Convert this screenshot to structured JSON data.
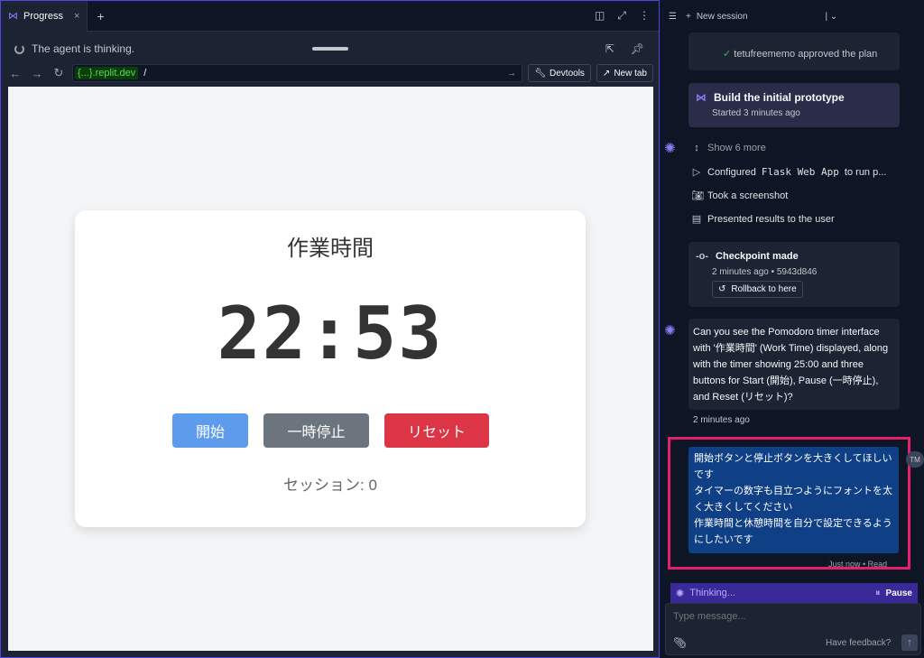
{
  "tab": {
    "label": "Progress",
    "close": "×",
    "add": "+"
  },
  "status": {
    "text": "The agent is thinking."
  },
  "url": {
    "domain": "{...}.replit.dev",
    "path": "/",
    "devtools": "Devtools",
    "newtab": "New tab"
  },
  "app": {
    "title": "作業時間",
    "time": "22:53",
    "start": "開始",
    "pause": "一時停止",
    "reset": "リセット",
    "session": "セッション: 0"
  },
  "side": {
    "new_session": "New session",
    "approved": "tetufreememo approved the plan",
    "task_title": "Build the initial prototype",
    "task_sub": "Started 3 minutes ago",
    "show_more": "Show 6 more",
    "step1_pre": "Configured",
    "step1_code": "Flask Web App",
    "step1_post": "to run p...",
    "step2": "Took a screenshot",
    "step3": "Presented results to the user",
    "checkpoint": "Checkpoint made",
    "checkpoint_meta": "2 minutes ago • 5943d846",
    "rollback": "Rollback to here",
    "agent_msg": "Can you see the Pomodoro timer interface with '作業時間' (Work Time) displayed, along with the timer showing 25:00 and three buttons for Start (開始), Pause (一時停止), and Reset (リセット)?",
    "agent_time": "2 minutes ago",
    "user_msg": "開始ボタンと停止ボタンを大きくしてほしいです\nタイマーの数字も目立つようにフォントを太く大きくしてください\n作業時間と休憩時間を自分で設定できるようにしたいです",
    "user_initials": "TM",
    "user_meta": "Just now • Read",
    "thinking": "Thinking...",
    "pause": "Pause",
    "placeholder": "Type message...",
    "feedback": "Have feedback?"
  }
}
